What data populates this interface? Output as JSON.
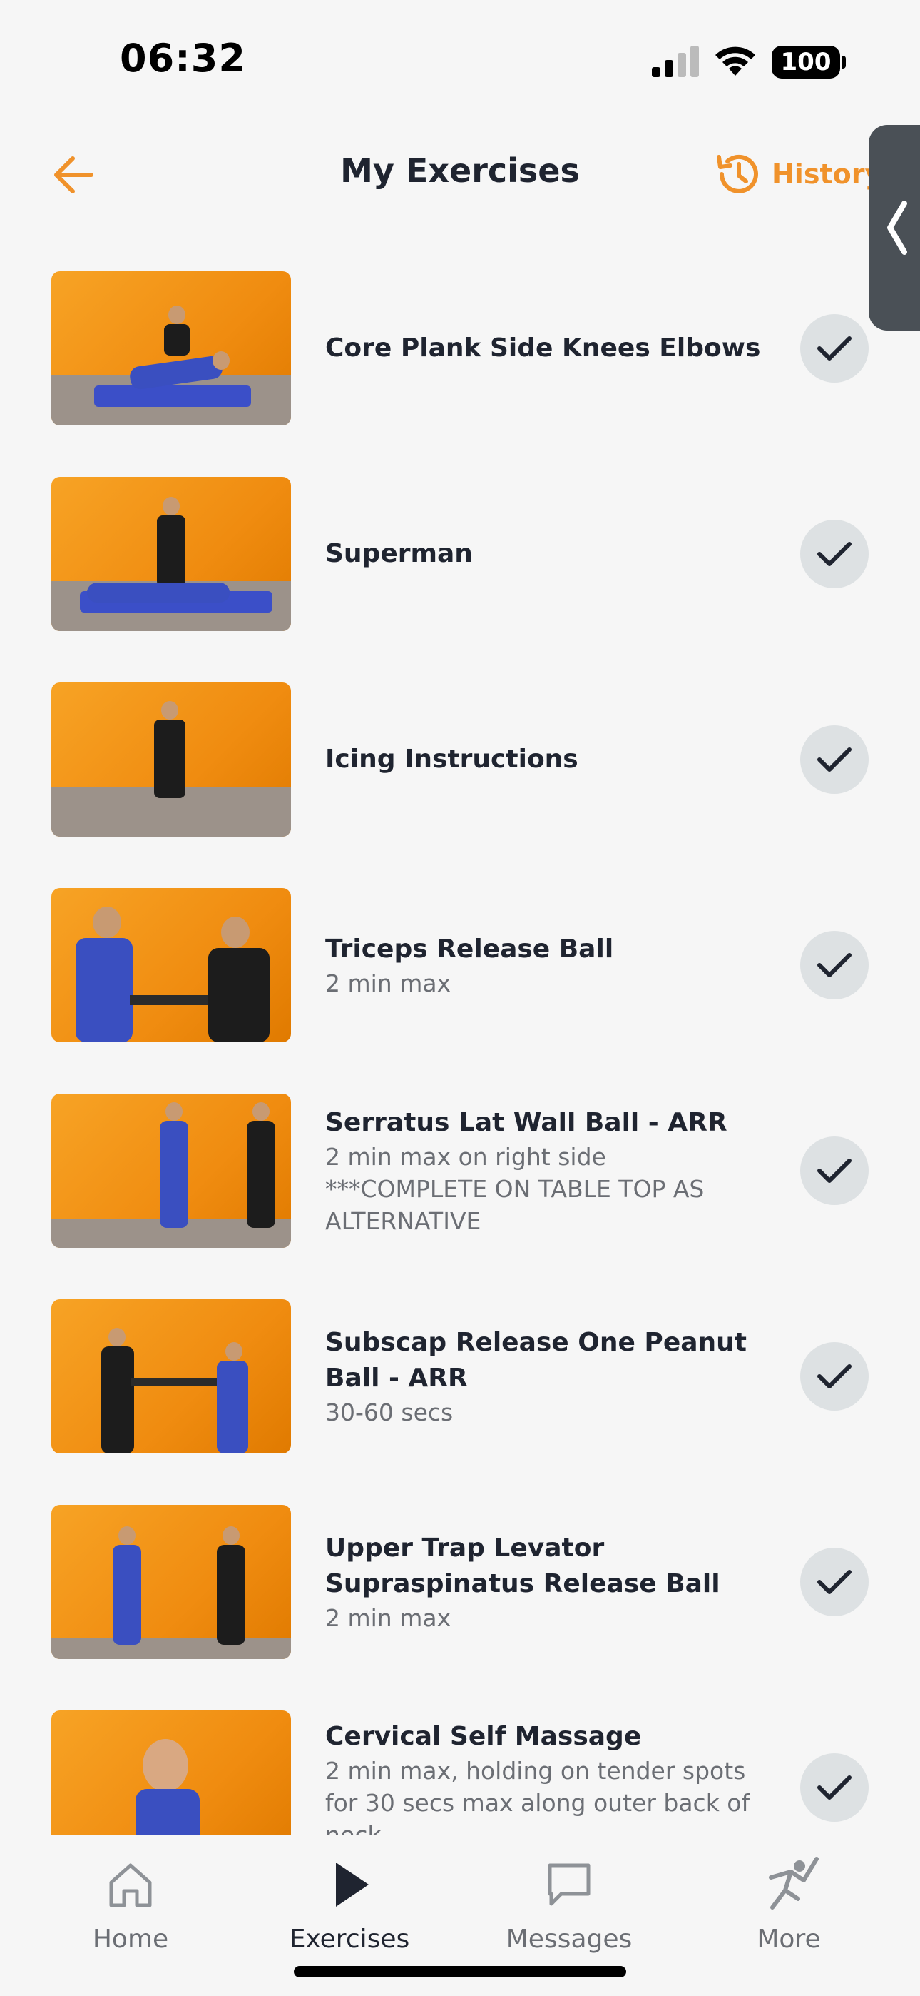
{
  "status_bar": {
    "time": "06:32",
    "battery": "100"
  },
  "header": {
    "title": "My Exercises",
    "history_label": "History"
  },
  "exercises": [
    {
      "title": "Core Plank Side Knees Elbows",
      "desc": ""
    },
    {
      "title": "Superman",
      "desc": ""
    },
    {
      "title": "Icing Instructions",
      "desc": ""
    },
    {
      "title": "Triceps Release Ball",
      "desc": "2 min max"
    },
    {
      "title": "Serratus Lat Wall Ball - ARR",
      "desc": "2 min max on right side\n***COMPLETE ON TABLE TOP AS ALTERNATIVE"
    },
    {
      "title": "Subscap Release One Peanut Ball - ARR",
      "desc": "30-60 secs"
    },
    {
      "title": "Upper Trap Levator Supraspinatus Release Ball",
      "desc": "2 min max"
    },
    {
      "title": "Cervical Self Massage",
      "desc": "2 min max, holding on tender spots for 30 secs max along outer back of neck"
    }
  ],
  "tabs": [
    {
      "label": "Home",
      "icon": "home-icon"
    },
    {
      "label": "Exercises",
      "icon": "play-icon"
    },
    {
      "label": "Messages",
      "icon": "message-icon"
    },
    {
      "label": "More",
      "icon": "runner-icon"
    }
  ],
  "colors": {
    "accent": "#f0922b",
    "check_bg": "#dde1e3",
    "background": "#f6f6f6"
  }
}
